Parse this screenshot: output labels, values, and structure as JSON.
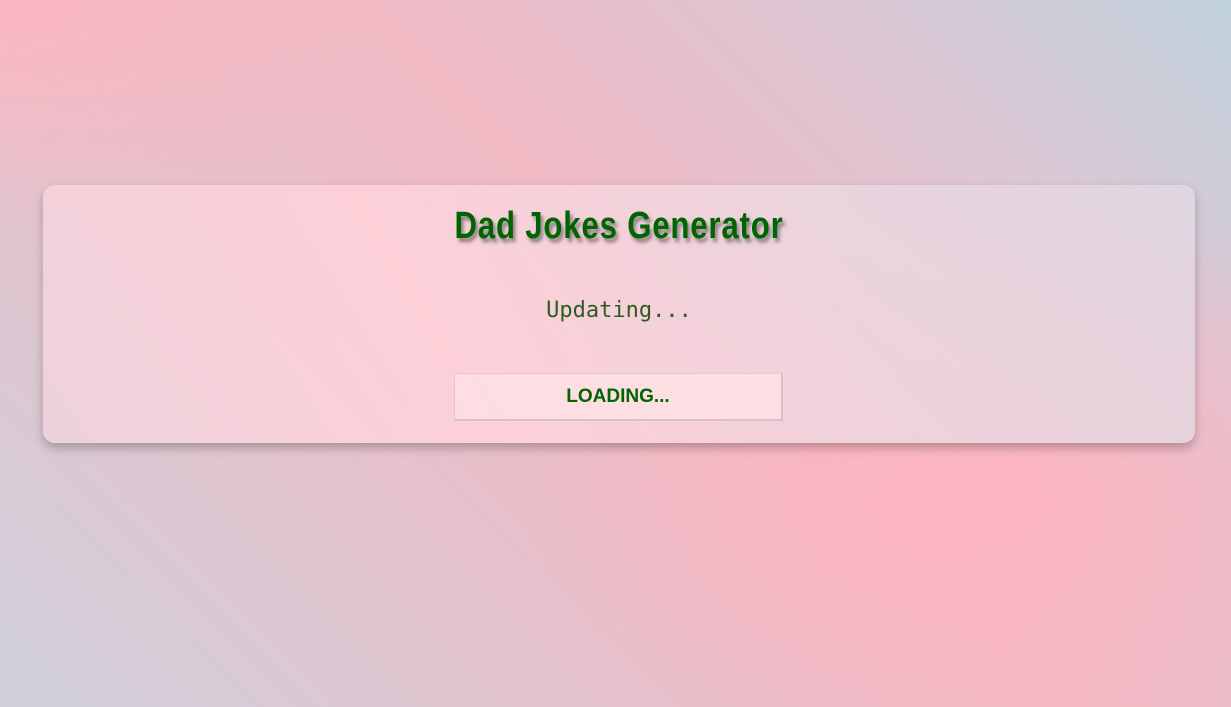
{
  "app": {
    "title": "Dad Jokes Generator"
  },
  "joke": {
    "text": "Updating..."
  },
  "button": {
    "label": "LOADING..."
  },
  "colors": {
    "accent": "#006400",
    "background_pink": "#ffb6c1",
    "background_blue": "#c2d2dc"
  }
}
